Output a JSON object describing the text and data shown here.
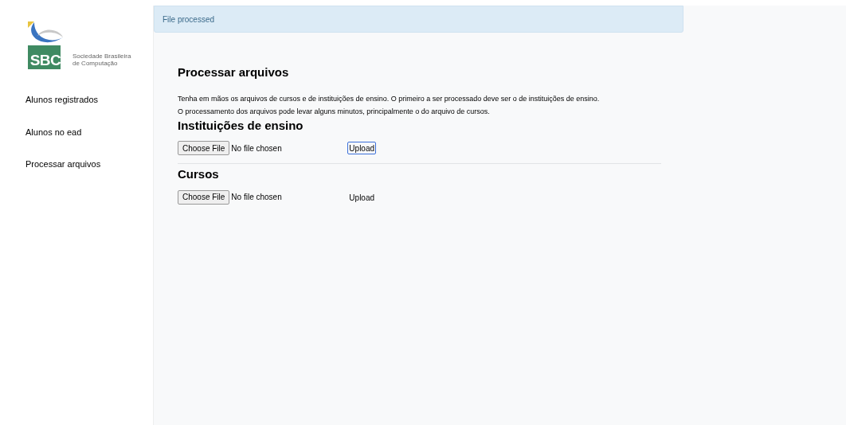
{
  "logo": {
    "mark": "SBC",
    "name_lines": [
      "Sociedade Brasileira",
      "de Computação"
    ]
  },
  "sidebar": {
    "items": [
      {
        "label": "Alunos registrados"
      },
      {
        "label": "Alunos no ead"
      },
      {
        "label": "Processar arquivos"
      }
    ]
  },
  "alert": {
    "text": "File processed"
  },
  "page": {
    "title": "Processar arquivos",
    "description": [
      "Tenha em mãos os arquivos de cursos e de instituições de ensino. O primeiro a ser processado deve ser o de instituições de ensino.",
      "O processamento dos arquivos pode levar alguns minutos, principalmente o do arquivo de cursos."
    ]
  },
  "sections": [
    {
      "title": "Instituições de ensino",
      "choose_label": "Choose File",
      "file_status": "No file chosen",
      "upload_label": "Upload",
      "upload_focused": true
    },
    {
      "title": "Cursos",
      "choose_label": "Choose File",
      "file_status": "No file chosen",
      "upload_label": "Upload",
      "upload_focused": false
    }
  ]
}
